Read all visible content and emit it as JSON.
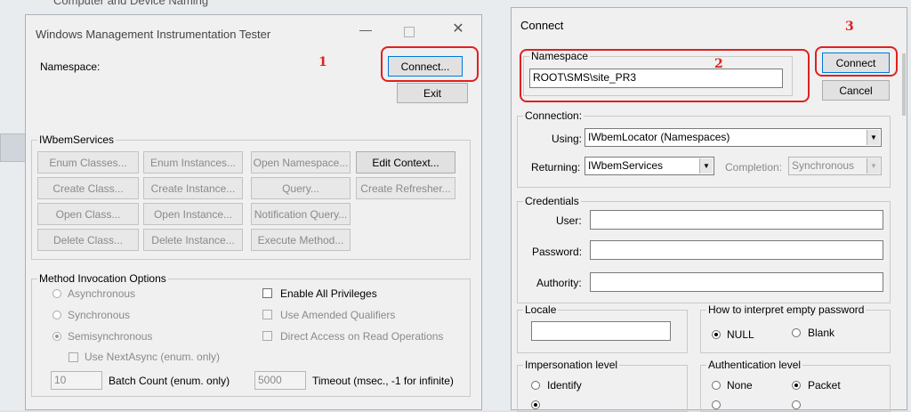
{
  "background_title": "Computer and Device Naming",
  "wmi": {
    "title": "Windows Management Instrumentation Tester",
    "namespace_label": "Namespace:",
    "connect_label": "Connect...",
    "exit_label": "Exit",
    "services_legend": "IWbemServices",
    "buttons": {
      "enum_classes": "Enum Classes...",
      "enum_instances": "Enum Instances...",
      "open_namespace": "Open Namespace...",
      "edit_context": "Edit Context...",
      "create_class": "Create Class...",
      "create_instance": "Create Instance...",
      "query": "Query...",
      "create_refresher": "Create Refresher...",
      "open_class": "Open Class...",
      "open_instance": "Open Instance...",
      "notification_query": "Notification Query...",
      "delete_class": "Delete Class...",
      "delete_instance": "Delete Instance...",
      "execute_method": "Execute Method..."
    },
    "options_legend": "Method Invocation Options",
    "asynchronous": "Asynchronous",
    "synchronous": "Synchronous",
    "semisynchronous": "Semisynchronous",
    "use_next_async": "Use NextAsync (enum. only)",
    "enable_all_privileges": "Enable All Privileges",
    "use_amended_qualifiers": "Use Amended Qualifiers",
    "direct_access": "Direct Access on Read Operations",
    "batch_count_value": "10",
    "batch_count_label": "Batch Count (enum. only)",
    "timeout_value": "5000",
    "timeout_label": "Timeout (msec., -1 for infinite)"
  },
  "connect": {
    "title": "Connect",
    "namespace_legend": "Namespace",
    "namespace_value": "ROOT\\SMS\\site_PR3",
    "connect_label": "Connect",
    "cancel_label": "Cancel",
    "connection_legend": "Connection:",
    "using_label": "Using:",
    "using_value": "IWbemLocator (Namespaces)",
    "returning_label": "Returning:",
    "returning_value": "IWbemServices",
    "completion_label": "Completion:",
    "completion_value": "Synchronous",
    "credentials_legend": "Credentials",
    "user_label": "User:",
    "password_label": "Password:",
    "authority_label": "Authority:",
    "locale_legend": "Locale",
    "empty_password_legend": "How to interpret empty password",
    "null_label": "NULL",
    "blank_label": "Blank",
    "impersonation_legend": "Impersonation level",
    "identify_label": "Identify",
    "authentication_legend": "Authentication level",
    "none_label": "None",
    "packet_label": "Packet"
  },
  "markers": [
    "1",
    "2",
    "3"
  ],
  "colors": {
    "annotation": "#e02020",
    "focus": "#0078d7"
  }
}
